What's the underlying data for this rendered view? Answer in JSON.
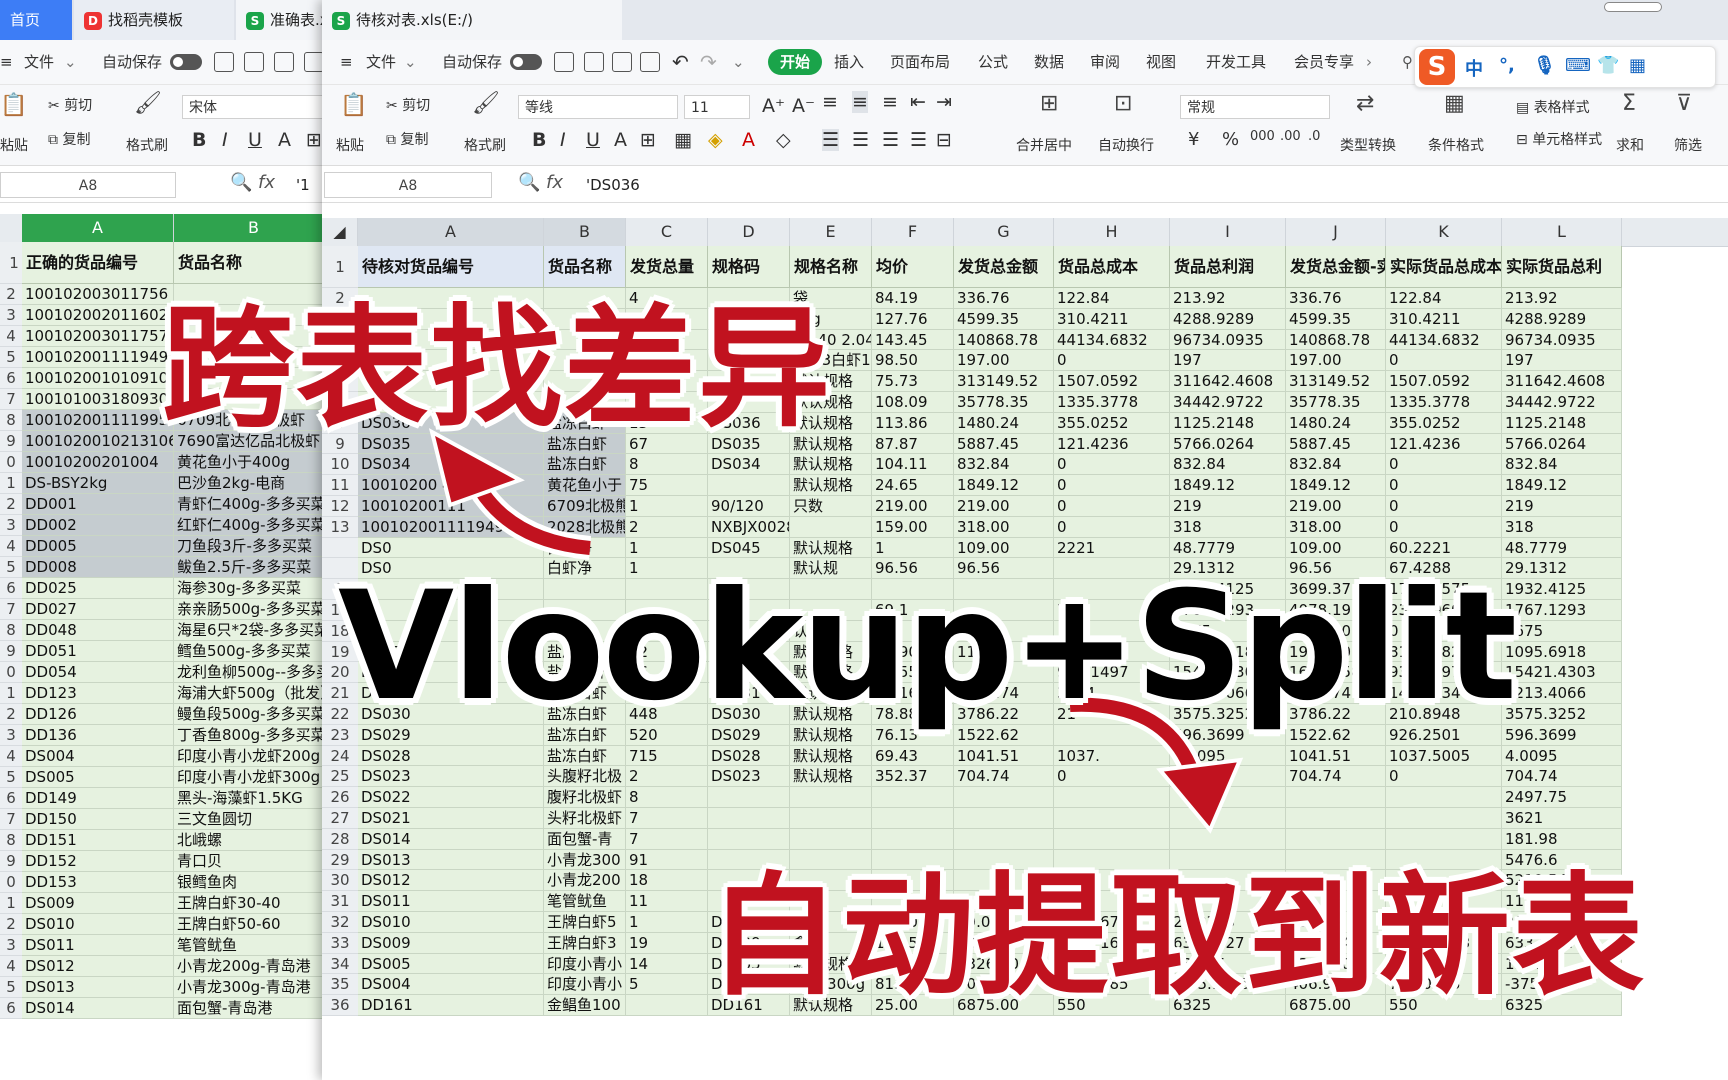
{
  "back": {
    "tabs": [
      {
        "label": "首页",
        "icon": "home"
      },
      {
        "label": "找稻壳模板",
        "icon": "docer-icon"
      },
      {
        "label": "准确表.xls",
        "icon": "sheet-icon"
      }
    ],
    "menu": {
      "file": "文件",
      "autosave": "自动保存"
    },
    "ribbon": {
      "paste": "粘贴",
      "cut": "剪切",
      "copy": "复制",
      "format_painter": "格式刷",
      "font": "宋体"
    },
    "namebox": "A8",
    "formula": "'1",
    "columns": [
      "A",
      "B"
    ],
    "headers": [
      "正确的货品编号",
      "货品名称"
    ],
    "rows": [
      {
        "n": "2",
        "a": "100102003011756",
        "b": ""
      },
      {
        "n": "3",
        "a": "100102002011602",
        "b": ""
      },
      {
        "n": "4",
        "a": "100102003011757",
        "b": ""
      },
      {
        "n": "5",
        "a": "100102001111949",
        "b": ""
      },
      {
        "n": "6",
        "a": "100102001010910",
        "b": ""
      },
      {
        "n": "7",
        "a": "100101003180930",
        "b": "京 鳗"
      },
      {
        "n": "8",
        "a": "100102001111995",
        "b": "6709北极熊北极虾"
      },
      {
        "n": "9",
        "a": "10010200102131067",
        "b": "7690富达亿品北极虾"
      },
      {
        "n": "0",
        "a": "10010200201004",
        "b": "黄花鱼小于400g"
      },
      {
        "n": "1",
        "a": "DS-BSY2kg",
        "b": "巴沙鱼2kg-电商"
      },
      {
        "n": "2",
        "a": "DD001",
        "b": "青虾仁400g-多多买菜"
      },
      {
        "n": "3",
        "a": "DD002",
        "b": "红虾仁400g-多多买菜"
      },
      {
        "n": "4",
        "a": "DD005",
        "b": "刀鱼段3斤-多多买菜"
      },
      {
        "n": "5",
        "a": "DD008",
        "b": "鲅鱼2.5斤-多多买菜"
      },
      {
        "n": "6",
        "a": "DD025",
        "b": "海参30g-多多买菜"
      },
      {
        "n": "7",
        "a": "DD027",
        "b": "亲亲肠500g-多多买菜"
      },
      {
        "n": "8",
        "a": "DD048",
        "b": "海星6只*2袋-多多买菜"
      },
      {
        "n": "9",
        "a": "DD051",
        "b": "鳕鱼500g-多多买菜"
      },
      {
        "n": "0",
        "a": "DD054",
        "b": "龙利鱼柳500g--多多买菜"
      },
      {
        "n": "1",
        "a": "DD123",
        "b": "海浦大虾500g（批发）"
      },
      {
        "n": "2",
        "a": "DD126",
        "b": "鳗鱼段500g-多多买菜"
      },
      {
        "n": "3",
        "a": "DD136",
        "b": "丁香鱼800g-多多买菜"
      },
      {
        "n": "4",
        "a": "DS004",
        "b": "印度小青小龙虾200g"
      },
      {
        "n": "5",
        "a": "DS005",
        "b": "印度小青小龙虾300g"
      },
      {
        "n": "6",
        "a": "DD149",
        "b": "黑头-海藻虾1.5KG"
      },
      {
        "n": "7",
        "a": "DD150",
        "b": "三文鱼圆切"
      },
      {
        "n": "8",
        "a": "DD151",
        "b": "北峨螺"
      },
      {
        "n": "9",
        "a": "DD152",
        "b": "青口贝"
      },
      {
        "n": "0",
        "a": "DD153",
        "b": "银鳕鱼肉"
      },
      {
        "n": "1",
        "a": "DS009",
        "b": "王牌白虾30-40"
      },
      {
        "n": "2",
        "a": "DS010",
        "b": "王牌白虾50-60"
      },
      {
        "n": "3",
        "a": "DS011",
        "b": "笔管鱿鱼"
      },
      {
        "n": "4",
        "a": "DS012",
        "b": "小青龙200g-青岛港"
      },
      {
        "n": "5",
        "a": "DS013",
        "b": "小青龙300g-青岛港"
      },
      {
        "n": "6",
        "a": "DS014",
        "b": "面包蟹-青岛港"
      }
    ]
  },
  "front": {
    "tab": {
      "label": "待核对表.xls(E:/)"
    },
    "menu": {
      "file": "文件",
      "autosave": "自动保存",
      "start": "开始",
      "insert": "插入",
      "layout": "页面布局",
      "formula": "公式",
      "data": "数据",
      "review": "审阅",
      "view": "视图",
      "developer": "开发工具",
      "vip": "会员专享"
    },
    "ribbon": {
      "paste": "粘贴",
      "cut": "剪切",
      "copy": "复制",
      "format_painter": "格式刷",
      "font": "等线",
      "size": "11",
      "merge": "合并居中",
      "wrap": "自动换行",
      "number_format": "常规",
      "type_convert": "类型转换",
      "cond_format": "条件格式",
      "table_style": "表格样式",
      "cell_style": "单元格样式",
      "sum": "求和",
      "filter": "筛选"
    },
    "ime": {
      "cn": "中",
      "punct": "°,"
    },
    "namebox": "A8",
    "formula": "'DS036",
    "columns": [
      "A",
      "B",
      "C",
      "D",
      "E",
      "F",
      "G",
      "H",
      "I",
      "J",
      "K",
      "L"
    ],
    "headers": [
      "待核对货品编号",
      "货品名称",
      "发货总量",
      "规格码",
      "规格名称",
      "均价",
      "发货总金额",
      "货品总成本",
      "货品总利润",
      "发货总金额-实",
      "实际货品总成本",
      "实际货品总利"
    ],
    "rows": [
      {
        "n": "2",
        "c": [
          "",
          "",
          "4",
          "",
          "袋",
          "84.19",
          "336.76",
          "122.84",
          "213.92",
          "336.76",
          "122.84",
          "213.92"
        ]
      },
      {
        "n": "3",
        "c": [
          "",
          "",
          "36",
          "",
          "2kg",
          "127.76",
          "4599.35",
          "310.4211",
          "4288.9289",
          "4599.35",
          "310.4211",
          "4288.9289"
        ]
      },
      {
        "n": "4",
        "c": [
          "",
          "",
          "22",
          "",
          "30-40 2.04",
          "143.45",
          "140868.78",
          "44134.6832",
          "96734.0935",
          "140868.78",
          "44134.6832",
          "96734.0935"
        ]
      },
      {
        "n": "5",
        "c": [
          "",
          "",
          "",
          "",
          "0363白虾1",
          "98.50",
          "197.00",
          "0",
          "197",
          "197.00",
          "0",
          "197"
        ]
      },
      {
        "n": "6",
        "c": [
          "",
          "",
          "35",
          "",
          "默认规格",
          "75.73",
          "313149.52",
          "1507.0592",
          "311642.4608",
          "313149.52",
          "1507.0592",
          "311642.4608"
        ]
      },
      {
        "n": "7",
        "c": [
          "",
          "",
          "21",
          "37",
          "默认规格",
          "108.09",
          "35778.35",
          "1335.3778",
          "34442.9722",
          "35778.35",
          "1335.3778",
          "34442.9722"
        ]
      },
      {
        "n": "8",
        "c": [
          "DS036",
          "盐冻白虾",
          "13",
          "DS036",
          "默认规格",
          "113.86",
          "1480.24",
          "355.0252",
          "1125.2148",
          "1480.24",
          "355.0252",
          "1125.2148"
        ]
      },
      {
        "n": "9",
        "c": [
          "DS035",
          "盐冻白虾",
          "67",
          "DS035",
          "默认规格",
          "87.87",
          "5887.45",
          "121.4236",
          "5766.0264",
          "5887.45",
          "121.4236",
          "5766.0264"
        ]
      },
      {
        "n": "10",
        "c": [
          "DS034",
          "盐冻白虾",
          "8",
          "DS034",
          "默认规格",
          "104.11",
          "832.84",
          "0",
          "832.84",
          "832.84",
          "0",
          "832.84"
        ]
      },
      {
        "n": "11",
        "c": [
          "10010200 4",
          "黄花鱼小于",
          "75",
          "",
          "默认规格",
          "24.65",
          "1849.12",
          "0",
          "1849.12",
          "1849.12",
          "0",
          "1849.12"
        ]
      },
      {
        "n": "12",
        "c": [
          "10010200111",
          "6709北极熊",
          "1",
          "90/120",
          "只数",
          "219.00",
          "219.00",
          "0",
          "219",
          "219.00",
          "0",
          "219"
        ]
      },
      {
        "n": "13",
        "c": [
          "100102001111949",
          "2028北极熊",
          "2",
          "NXBJX0028",
          "",
          "159.00",
          "318.00",
          "0",
          "318",
          "318.00",
          "0",
          "318"
        ]
      },
      {
        "n": "",
        "c": [
          "DS0",
          "白虾净",
          "1",
          "DS045",
          "默认规格",
          "1",
          "109.00",
          "2221",
          "48.7779",
          "109.00",
          "60.2221",
          "48.7779"
        ]
      },
      {
        "n": "",
        "c": [
          "DS0",
          "白虾净",
          "1",
          "",
          "默认规",
          "96.56",
          "96.56",
          "",
          "29.1312",
          "96.56",
          "67.4288",
          "29.1312"
        ]
      },
      {
        "n": "1",
        "c": [
          "",
          "",
          "",
          "",
          "",
          "",
          "",
          "",
          "1932.4125",
          "3699.37",
          "1766.9575",
          "1932.4125"
        ]
      },
      {
        "n": "17",
        "c": [
          "",
          "",
          "",
          "",
          "",
          "69.1",
          "",
          "7",
          "1767.1293",
          "4078.19",
          "2311.0607",
          "1767.1293"
        ]
      },
      {
        "n": "18",
        "c": [
          "9",
          "",
          "",
          "",
          "认规格",
          "",
          "",
          "",
          "1675",
          "1675.00",
          "0",
          "1675"
        ]
      },
      {
        "n": "19",
        "c": [
          "DS034",
          "盐冻白虾",
          "22",
          "",
          "默认规格",
          "86.90",
          "11.80",
          "816.1082",
          "1095.6918",
          "1911.80",
          "816.1082",
          "1095.6918"
        ]
      },
      {
        "n": "20",
        "c": [
          "DS032",
          "盐冻白虾",
          "26",
          "DS0",
          "默认规格",
          "98.55",
          "",
          "938.1497",
          "15421.4303",
          "16359.58",
          "938.1497",
          "15421.4303"
        ]
      },
      {
        "n": "21",
        "c": [
          "DS031",
          "盐冻白虾",
          "335",
          "DS031",
          "默认规格",
          "89.16",
          "9361.74",
          "3334",
          "9213.4066",
          "9361.74",
          "148.3334",
          "9213.4066"
        ]
      },
      {
        "n": "22",
        "c": [
          "DS030",
          "盐冻白虾",
          "448",
          "DS030",
          "默认规格",
          "78.88",
          "3786.22",
          "21",
          "3575.3252",
          "3786.22",
          "210.8948",
          "3575.3252"
        ]
      },
      {
        "n": "23",
        "c": [
          "DS029",
          "盐冻白虾",
          "520",
          "DS029",
          "默认规格",
          "76.13",
          "1522.62",
          "",
          "596.3699",
          "1522.62",
          "926.2501",
          "596.3699"
        ]
      },
      {
        "n": "24",
        "c": [
          "DS028",
          "盐冻白虾",
          "715",
          "DS028",
          "默认规格",
          "69.43",
          "1041.51",
          "1037.",
          "4.0095",
          "1041.51",
          "1037.5005",
          "4.0095"
        ]
      },
      {
        "n": "25",
        "c": [
          "DS023",
          "头腹籽北极",
          "2",
          "DS023",
          "默认规格",
          "352.37",
          "704.74",
          "0",
          "704.74",
          "704.74",
          "0",
          "704.74"
        ]
      },
      {
        "n": "26",
        "c": [
          "DS022",
          "腹籽北极虾",
          "8",
          "",
          "",
          "",
          "",
          "",
          "",
          "",
          "",
          "2497.75"
        ]
      },
      {
        "n": "27",
        "c": [
          "DS021",
          "头籽北极虾",
          "7",
          "",
          "",
          "",
          "",
          "",
          "",
          "",
          "",
          "3621"
        ]
      },
      {
        "n": "28",
        "c": [
          "DS014",
          "面包蟹-青",
          "7",
          "",
          "",
          "",
          "",
          "",
          "",
          "",
          "",
          "181.98"
        ]
      },
      {
        "n": "29",
        "c": [
          "DS013",
          "小青龙300",
          "91",
          "",
          "",
          "",
          "",
          "",
          "",
          "",
          "",
          "5476.6"
        ]
      },
      {
        "n": "30",
        "c": [
          "DS012",
          "小青龙200",
          "18",
          "",
          "",
          "",
          "",
          "",
          "",
          "",
          "",
          "5210.54"
        ]
      },
      {
        "n": "31",
        "c": [
          "DS011",
          "笔管鱿鱼",
          "11",
          "",
          "",
          "",
          "",
          "",
          "",
          "",
          "",
          "117.12"
        ]
      },
      {
        "n": "32",
        "c": [
          "DS010",
          "王牌白虾5",
          "1",
          "DS010",
          "盒",
          "99.00",
          "99.00",
          "69.1667",
          "29.8333",
          "99.00",
          "69.1667",
          "29.8333"
        ]
      },
      {
        "n": "33",
        "c": [
          "DS009",
          "王牌白虾3",
          "19",
          "DS009",
          "盒",
          "107.52",
          "2042.84",
          "1409.1673",
          "633.6727",
          "2042.84",
          "1409.1673",
          "633.6727"
        ]
      },
      {
        "n": "34",
        "c": [
          "DS005",
          "印度小青小",
          "14",
          "DS005",
          "默认规格",
          "94.75",
          "1326.50",
          "0",
          "1326.5",
          "1326.50",
          "0",
          "1326.5"
        ]
      },
      {
        "n": "35",
        "c": [
          "DS004",
          "印度小青小",
          "5",
          "DS004",
          "200-300g",
          "81.38",
          "406.90",
          "782.0585",
          "-375.1585",
          "406.90",
          "782.0585",
          "-375.1585"
        ]
      },
      {
        "n": "36",
        "c": [
          "DD161",
          "金鲳鱼100",
          "",
          "DD161",
          "默认规格",
          "25.00",
          "6875.00",
          "550",
          "6325",
          "6875.00",
          "550",
          "6325"
        ]
      }
    ]
  },
  "overlay": {
    "top": "跨表找差异",
    "middle": "Vlookup+Split",
    "bottom": "自动提取到新表"
  },
  "colors": {
    "accent_red": "#c1121f",
    "start_green": "#1aa44a",
    "cell_green": "#e6f2e0",
    "home_blue": "#3d7df6"
  }
}
